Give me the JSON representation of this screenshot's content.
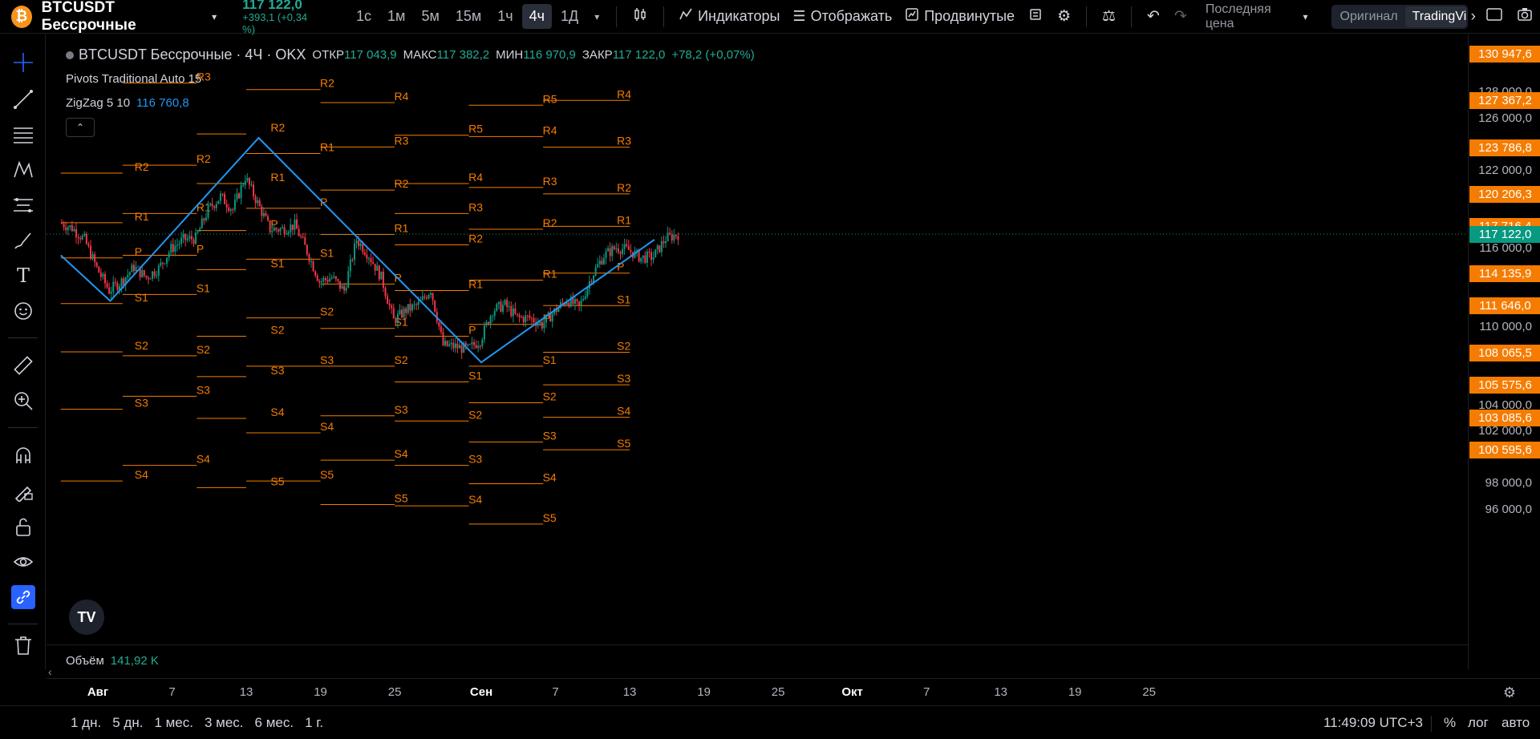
{
  "symbol": {
    "name": "BTCUSDT Бессрочные",
    "price": "117 122,0",
    "change": "+393,1 (+0,34 %)"
  },
  "intervals": [
    "1с",
    "1м",
    "5м",
    "15м",
    "1ч",
    "4ч",
    "1Д"
  ],
  "active_interval": "4ч",
  "toolbar": {
    "indicators": "Индикаторы",
    "display": "Отображать",
    "advanced": "Продвинутые",
    "price_type": "Последняя цена",
    "original": "Оригинал",
    "tradingview": "TradingView"
  },
  "legend": {
    "title": "BTCUSDT Бессрочные · 4Ч · OKX",
    "open_label": "ОТКР",
    "open": "117 043,9",
    "high_label": "МАКС",
    "high": "117 382,2",
    "low_label": "МИН",
    "low": "116 970,9",
    "close_label": "ЗАКР",
    "close": "117 122,0",
    "change": "+78,2 (+0,07%)"
  },
  "indicators": [
    {
      "name": "Pivots Traditional Auto 15",
      "value": ""
    },
    {
      "name": "ZigZag 5 10",
      "value": "116 760,8"
    }
  ],
  "volume": {
    "label": "Объём",
    "value": "141,92 K"
  },
  "price_axis": {
    "ticks": [
      {
        "price": 128000,
        "label": "128 000,0"
      },
      {
        "price": 126000,
        "label": "126 000,0"
      },
      {
        "price": 122000,
        "label": "122 000,0"
      },
      {
        "price": 116000,
        "label": "116 000,0"
      },
      {
        "price": 110000,
        "label": "110 000,0"
      },
      {
        "price": 104000,
        "label": "104 000,0"
      },
      {
        "price": 102000,
        "label": "102 000,0"
      },
      {
        "price": 98000,
        "label": "98 000,0"
      },
      {
        "price": 96000,
        "label": "96 000,0"
      }
    ],
    "level_labels": [
      {
        "price": 130947.6,
        "label": "130 947,6"
      },
      {
        "price": 127367.2,
        "label": "127 367,2"
      },
      {
        "price": 123786.8,
        "label": "123 786,8"
      },
      {
        "price": 120206.3,
        "label": "120 206,3"
      },
      {
        "price": 117716.4,
        "label": "117 716,4"
      },
      {
        "price": 114135.9,
        "label": "114 135,9"
      },
      {
        "price": 111646.0,
        "label": "111 646,0"
      },
      {
        "price": 108065.5,
        "label": "108 065,5"
      },
      {
        "price": 105575.6,
        "label": "105 575,6"
      },
      {
        "price": 103085.6,
        "label": "103 085,6"
      },
      {
        "price": 100595.6,
        "label": "100 595,6"
      }
    ],
    "current": {
      "price": 117122.0,
      "label": "117 122,0"
    }
  },
  "time_axis": [
    "Авг",
    "7",
    "13",
    "19",
    "25",
    "Сен",
    "7",
    "13",
    "19",
    "25",
    "Окт",
    "7",
    "13",
    "19",
    "25"
  ],
  "bottom": {
    "ranges": [
      "1 дн.",
      "5 дн.",
      "1 мес.",
      "3 мес.",
      "6 мес.",
      "1 г."
    ],
    "clock": "11:49:09 UTC+3",
    "percent": "%",
    "log": "лог",
    "auto": "авто"
  },
  "chart_data": {
    "type": "candlestick",
    "instrument": "BTCUSDT Бессрочные",
    "timeframe": "4Ч",
    "exchange": "OKX",
    "ylim": [
      94000,
      131500
    ],
    "ohlc_last": {
      "open": 117043.9,
      "high": 117382.2,
      "low": 116970.9,
      "close": 117122.0
    },
    "close_path": [
      {
        "x": "2025-07-29",
        "y": 118000
      },
      {
        "x": "2025-07-30",
        "y": 117600
      },
      {
        "x": "2025-07-31",
        "y": 116700
      },
      {
        "x": "2025-08-01",
        "y": 114500
      },
      {
        "x": "2025-08-02",
        "y": 112800
      },
      {
        "x": "2025-08-03",
        "y": 113500
      },
      {
        "x": "2025-08-04",
        "y": 114600
      },
      {
        "x": "2025-08-05",
        "y": 113800
      },
      {
        "x": "2025-08-06",
        "y": 114500
      },
      {
        "x": "2025-08-07",
        "y": 116000
      },
      {
        "x": "2025-08-08",
        "y": 116700
      },
      {
        "x": "2025-08-09",
        "y": 116800
      },
      {
        "x": "2025-08-10",
        "y": 119000
      },
      {
        "x": "2025-08-11",
        "y": 120000
      },
      {
        "x": "2025-08-12",
        "y": 119000
      },
      {
        "x": "2025-08-13",
        "y": 121500
      },
      {
        "x": "2025-08-14",
        "y": 119500
      },
      {
        "x": "2025-08-15",
        "y": 117500
      },
      {
        "x": "2025-08-16",
        "y": 117500
      },
      {
        "x": "2025-08-17",
        "y": 117800
      },
      {
        "x": "2025-08-18",
        "y": 115800
      },
      {
        "x": "2025-08-19",
        "y": 113500
      },
      {
        "x": "2025-08-20",
        "y": 113800
      },
      {
        "x": "2025-08-21",
        "y": 112800
      },
      {
        "x": "2025-08-22",
        "y": 116700
      },
      {
        "x": "2025-08-23",
        "y": 115500
      },
      {
        "x": "2025-08-24",
        "y": 113800
      },
      {
        "x": "2025-08-25",
        "y": 110500
      },
      {
        "x": "2025-08-26",
        "y": 111300
      },
      {
        "x": "2025-08-27",
        "y": 111700
      },
      {
        "x": "2025-08-28",
        "y": 112900
      },
      {
        "x": "2025-08-29",
        "y": 108600
      },
      {
        "x": "2025-08-30",
        "y": 108500
      },
      {
        "x": "2025-08-31",
        "y": 108300
      },
      {
        "x": "2025-09-01",
        "y": 109000
      },
      {
        "x": "2025-09-02",
        "y": 111300
      },
      {
        "x": "2025-09-03",
        "y": 111700
      },
      {
        "x": "2025-09-04",
        "y": 110700
      },
      {
        "x": "2025-09-05",
        "y": 110700
      },
      {
        "x": "2025-09-06",
        "y": 110200
      },
      {
        "x": "2025-09-07",
        "y": 111200
      },
      {
        "x": "2025-09-08",
        "y": 112100
      },
      {
        "x": "2025-09-09",
        "y": 111500
      },
      {
        "x": "2025-09-10",
        "y": 113900
      },
      {
        "x": "2025-09-11",
        "y": 115500
      },
      {
        "x": "2025-09-12",
        "y": 116100
      },
      {
        "x": "2025-09-13",
        "y": 115900
      },
      {
        "x": "2025-09-14",
        "y": 115300
      },
      {
        "x": "2025-09-15",
        "y": 115400
      },
      {
        "x": "2025-09-16",
        "y": 116800
      },
      {
        "x": "2025-09-17",
        "y": 117122
      }
    ],
    "zigzag": [
      {
        "x": "2025-07-29",
        "y": 115500
      },
      {
        "x": "2025-08-02",
        "y": 112000
      },
      {
        "x": "2025-08-14",
        "y": 124500
      },
      {
        "x": "2025-09-01",
        "y": 107300
      },
      {
        "x": "2025-09-15",
        "y": 116700
      }
    ],
    "pivot_levels": [
      {
        "period_start": "2025-07-29",
        "R2": 121800,
        "R1": 118000,
        "P": 115300,
        "S1": 111800,
        "S2": 108100,
        "S3": 103700,
        "S4": 98200
      },
      {
        "period_start": "2025-08-03",
        "R3": 128700,
        "R2": 122400,
        "R1": 118700,
        "P": 115500,
        "S1": 112500,
        "S2": 107800,
        "S3": 104700,
        "S4": 99400
      },
      {
        "period_start": "2025-08-09",
        "R2": 124800,
        "R1": 121000,
        "P": 117400,
        "S1": 114400,
        "S2": 109300,
        "S3": 106200,
        "S4": 103000,
        "S5": 97700
      },
      {
        "period_start": "2025-08-13",
        "R2": 128200,
        "R1": 123300,
        "P": 119100,
        "S1": 115200,
        "S2": 110700,
        "S3": 107000,
        "S4": 101900,
        "S5": 98200
      },
      {
        "period_start": "2025-08-19",
        "R4": 127200,
        "R3": 123800,
        "R2": 120500,
        "R1": 117100,
        "P": 113300,
        "S1": 109900,
        "S2": 107000,
        "S3": 103200,
        "S4": 99800,
        "S5": 96400
      },
      {
        "period_start": "2025-08-25",
        "R5": 124700,
        "R4": 121000,
        "R3": 118700,
        "R2": 116300,
        "R1": 112800,
        "P": 109300,
        "S1": 105800,
        "S2": 102800,
        "S3": 99400,
        "S4": 96300
      },
      {
        "period_start": "2025-08-31",
        "R5": 127000,
        "R4": 124600,
        "R3": 120700,
        "R2": 117500,
        "R1": 113600,
        "P": 110200,
        "S1": 107000,
        "S2": 104200,
        "S3": 101200,
        "S4": 98000,
        "S5": 94900
      },
      {
        "period_start": "2025-09-06",
        "R4": 127367.2,
        "R3": 123786.8,
        "R2": 120206.3,
        "R1": 117716.4,
        "P": 114135.9,
        "S1": 111646.0,
        "S2": 108065.5,
        "S3": 105575.6,
        "S4": 103085.6,
        "S5": 100595.6
      }
    ]
  }
}
